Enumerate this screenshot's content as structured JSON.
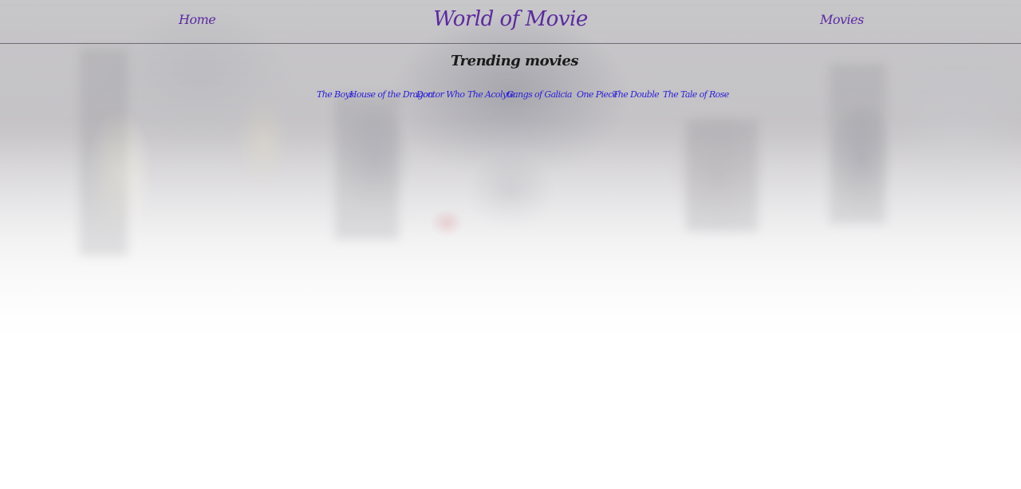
{
  "nav": {
    "home_label": "Home",
    "site_title": "World of Movie",
    "movies_label": "Movies"
  },
  "trending": {
    "heading": "Trending movies",
    "movies": [
      "The Boys",
      "House of the Dragon",
      "Doctor Who",
      "The Acolyte",
      "Gangs of Galicia",
      "One Piece",
      "The Double",
      "The Tale of Rose"
    ]
  },
  "colors": {
    "nav_text": "#5a2aa0",
    "movie_link": "#2a1fd6",
    "heading_text": "#1a1a1a",
    "divider": "#6e6a72"
  }
}
